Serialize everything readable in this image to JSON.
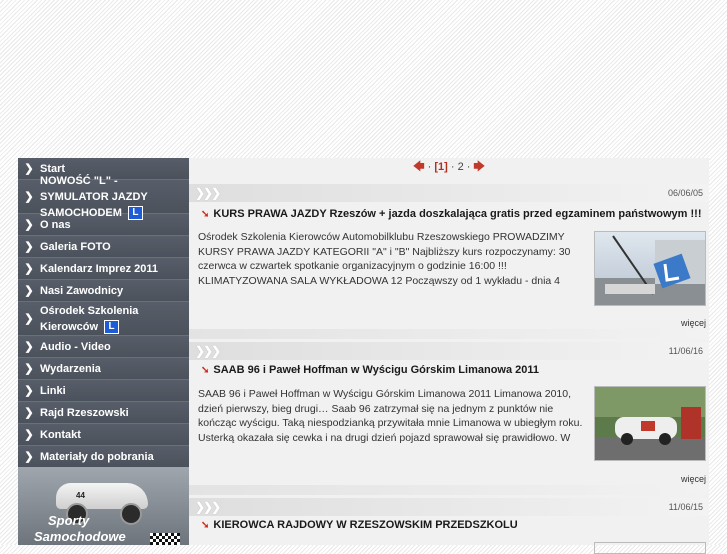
{
  "nav": {
    "items": [
      {
        "label": "Start"
      },
      {
        "label": "NOWOŚĆ \"L\" - SYMULATOR JAZDY SAMOCHODEM",
        "badge": "L"
      },
      {
        "label": "O nas"
      },
      {
        "label": "Galeria FOTO"
      },
      {
        "label": "Kalendarz Imprez 2011"
      },
      {
        "label": "Nasi Zawodnicy"
      },
      {
        "label": "Ośrodek Szkolenia Kierowców",
        "badge": "L"
      },
      {
        "label": "Audio - Video"
      },
      {
        "label": "Wydarzenia"
      },
      {
        "label": "Linki"
      },
      {
        "label": "Rajd Rzeszowski"
      },
      {
        "label": "Kontakt"
      },
      {
        "label": "Materiały do pobrania"
      }
    ],
    "arrow_icon": "chevron-right-icon"
  },
  "promo": {
    "line1": "Sporty",
    "line2": "Samochodowe",
    "car_number": "44"
  },
  "pager": {
    "prev_icon": "arrow-left-icon",
    "next_icon": "arrow-right-icon",
    "current": "[1]",
    "page2": "2",
    "sep": "·"
  },
  "articles": [
    {
      "date": "06/06/05",
      "title": "KURS PRAWA JAZDY Rzeszów + jazda doszkalająca gratis przed egzaminem państwowym !!!",
      "excerpt": "Ośrodek Szkolenia Kierowców Automobilklubu Rzeszowskiego PROWADZIMY KURSY PRAWA JAZDY KATEGORII \"A\" i \"B\" Najbliższy kurs rozpoczynamy: 30 czerwca w czwartek spotkanie organizacyjnym o godzinie 16:00 !!! KLIMATYZOWANA SALA WYKŁADOWA 12 Począwszy od 1 wykładu - dnia 4",
      "more": "więcej"
    },
    {
      "date": "11/06/16",
      "title": "SAAB 96 i Paweł Hoffman w Wyścigu Górskim Limanowa 2011",
      "excerpt": "SAAB 96 i Paweł Hoffman w Wyścigu Górskim Limanowa 2011   Limanowa 2010, dzień pierwszy, bieg drugi… Saab 96 zatrzymał się na jednym z punktów nie kończąc wyścigu. Taką niespodzianką przywitała mnie Limanowa w ubiegłym roku. Usterką okazała się cewka i na drugi dzień pojazd sprawował się prawidłowo. W",
      "more": "więcej"
    },
    {
      "date": "11/06/15",
      "title": "KIEROWCA RAJDOWY W RZESZOWSKIM PRZEDSZKOLU"
    }
  ],
  "colors": {
    "sidebar": "#4f5560",
    "accent_red": "#d12a1b",
    "badge_blue": "#1e5bd6"
  }
}
